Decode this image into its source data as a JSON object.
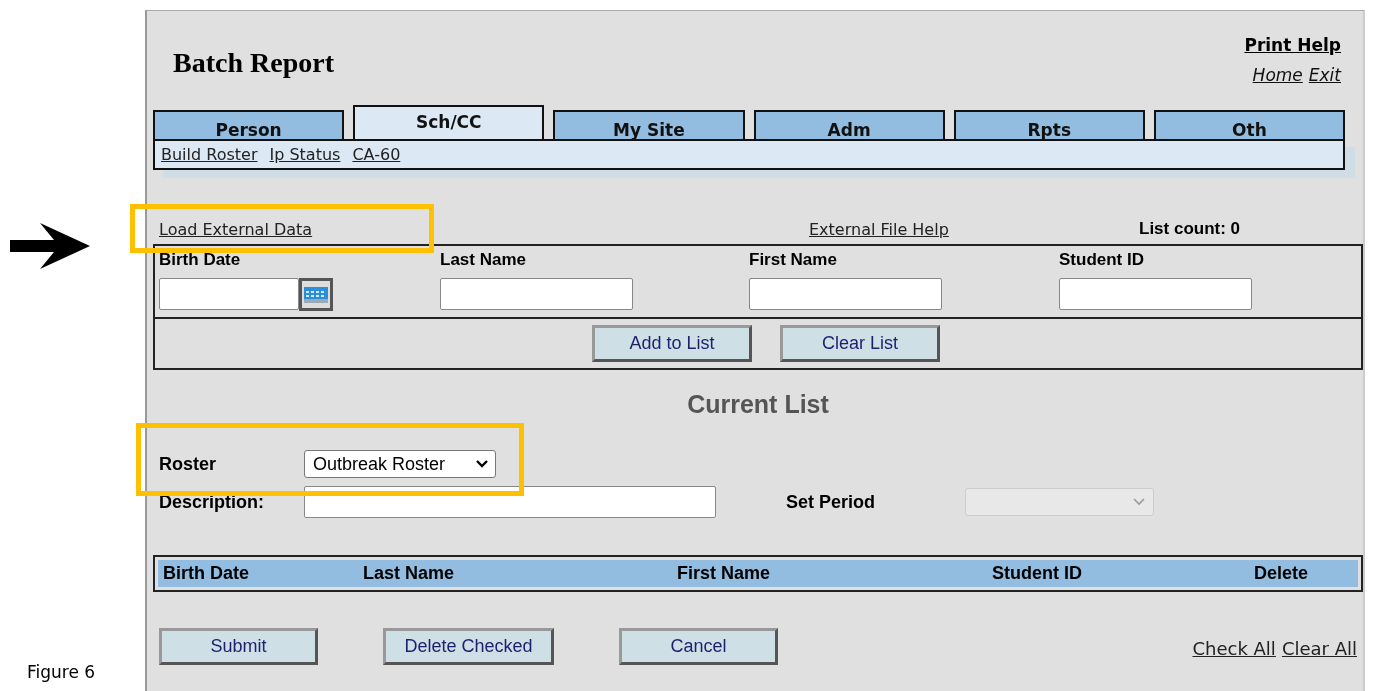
{
  "header": {
    "title": "Batch Report",
    "print_help": "Print Help",
    "links": [
      "Home",
      "Exit"
    ]
  },
  "tabs": [
    {
      "label": "Person",
      "selected": false
    },
    {
      "label": "Sch/CC",
      "selected": true
    },
    {
      "label": "My Site",
      "selected": false
    },
    {
      "label": "Adm",
      "selected": false
    },
    {
      "label": "Rpts",
      "selected": false
    },
    {
      "label": "Oth",
      "selected": false
    }
  ],
  "subnav": [
    "Build Roster",
    "Ip Status",
    "CA-60"
  ],
  "load_link": {
    "label": "Load External Data",
    "highlighted": true
  },
  "file_help": "External File Help",
  "list_count": "List count: 0",
  "entry_fields": [
    {
      "label": "Birth Date",
      "kind": "date"
    },
    {
      "label": "Last Name",
      "kind": "text"
    },
    {
      "label": "First Name",
      "kind": "text"
    },
    {
      "label": "Student ID",
      "kind": "text"
    }
  ],
  "entry_buttons": [
    "Add to List",
    "Clear List"
  ],
  "current_list_title": "Current List",
  "roster": {
    "label": "Roster",
    "value": "Outbreak Roster",
    "highlighted": true
  },
  "description": {
    "label": "Description:"
  },
  "set_period": {
    "label": "Set Period",
    "disabled": true
  },
  "list_columns": [
    "Birth Date",
    "Last Name",
    "First Name",
    "Student ID",
    "Delete"
  ],
  "action_buttons": [
    "Submit",
    "Delete Checked",
    "Cancel"
  ],
  "check_links": [
    "Check All",
    "Clear All"
  ],
  "caption": "Figure 6"
}
